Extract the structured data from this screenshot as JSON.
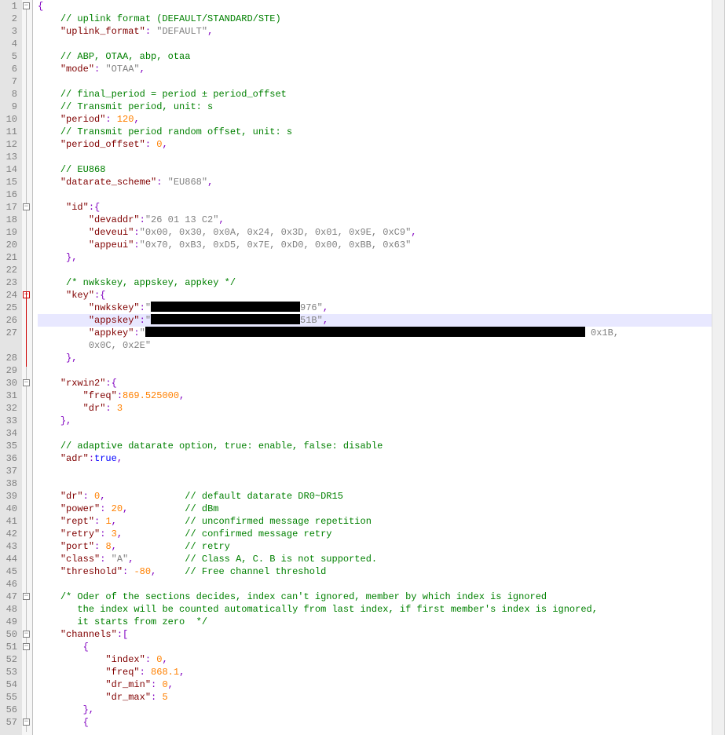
{
  "lines": {
    "l1": {
      "t": [
        {
          "c": "p",
          "v": "{"
        }
      ]
    },
    "l2": {
      "t": [
        {
          "c": "",
          "v": "    "
        },
        {
          "c": "c",
          "v": "// uplink format (DEFAULT/STANDARD/STE)"
        }
      ]
    },
    "l3": {
      "t": [
        {
          "c": "",
          "v": "    "
        },
        {
          "c": "k",
          "v": "\"uplink_format\""
        },
        {
          "c": "p",
          "v": ": "
        },
        {
          "c": "s",
          "v": "\"DEFAULT\""
        },
        {
          "c": "p",
          "v": ","
        }
      ]
    },
    "l4": {
      "t": [
        {
          "c": "",
          "v": ""
        }
      ]
    },
    "l5": {
      "t": [
        {
          "c": "",
          "v": "    "
        },
        {
          "c": "c",
          "v": "// ABP, OTAA, abp, otaa"
        }
      ]
    },
    "l6": {
      "t": [
        {
          "c": "",
          "v": "    "
        },
        {
          "c": "k",
          "v": "\"mode\""
        },
        {
          "c": "p",
          "v": ": "
        },
        {
          "c": "s",
          "v": "\"OTAA\""
        },
        {
          "c": "p",
          "v": ","
        }
      ]
    },
    "l7": {
      "t": [
        {
          "c": "",
          "v": ""
        }
      ]
    },
    "l8": {
      "t": [
        {
          "c": "",
          "v": "    "
        },
        {
          "c": "c",
          "v": "// final_period = period ± period_offset"
        }
      ]
    },
    "l9": {
      "t": [
        {
          "c": "",
          "v": "    "
        },
        {
          "c": "c",
          "v": "// Transmit period, unit: s"
        }
      ]
    },
    "l10": {
      "t": [
        {
          "c": "",
          "v": "    "
        },
        {
          "c": "k",
          "v": "\"period\""
        },
        {
          "c": "p",
          "v": ": "
        },
        {
          "c": "n",
          "v": "120"
        },
        {
          "c": "p",
          "v": ","
        }
      ]
    },
    "l11": {
      "t": [
        {
          "c": "",
          "v": "    "
        },
        {
          "c": "c",
          "v": "// Transmit period random offset, unit: s"
        }
      ]
    },
    "l12": {
      "t": [
        {
          "c": "",
          "v": "    "
        },
        {
          "c": "k",
          "v": "\"period_offset\""
        },
        {
          "c": "p",
          "v": ": "
        },
        {
          "c": "n",
          "v": "0"
        },
        {
          "c": "p",
          "v": ","
        }
      ]
    },
    "l13": {
      "t": [
        {
          "c": "",
          "v": ""
        }
      ]
    },
    "l14": {
      "t": [
        {
          "c": "",
          "v": "    "
        },
        {
          "c": "c",
          "v": "// EU868"
        }
      ]
    },
    "l15": {
      "t": [
        {
          "c": "",
          "v": "    "
        },
        {
          "c": "k",
          "v": "\"datarate_scheme\""
        },
        {
          "c": "p",
          "v": ": "
        },
        {
          "c": "s",
          "v": "\"EU868\""
        },
        {
          "c": "p",
          "v": ","
        }
      ]
    },
    "l16": {
      "t": [
        {
          "c": "",
          "v": ""
        }
      ]
    },
    "l17": {
      "t": [
        {
          "c": "",
          "v": "     "
        },
        {
          "c": "k",
          "v": "\"id\""
        },
        {
          "c": "p",
          "v": ":{"
        }
      ]
    },
    "l18": {
      "t": [
        {
          "c": "",
          "v": "         "
        },
        {
          "c": "k",
          "v": "\"devaddr\""
        },
        {
          "c": "p",
          "v": ":"
        },
        {
          "c": "s",
          "v": "\"26 01 13 C2\""
        },
        {
          "c": "p",
          "v": ","
        }
      ]
    },
    "l19": {
      "t": [
        {
          "c": "",
          "v": "         "
        },
        {
          "c": "k",
          "v": "\"deveui\""
        },
        {
          "c": "p",
          "v": ":"
        },
        {
          "c": "s",
          "v": "\"0x00, 0x30, 0x0A, 0x24, 0x3D, 0x01, 0x9E, 0xC9\""
        },
        {
          "c": "p",
          "v": ","
        }
      ]
    },
    "l20": {
      "t": [
        {
          "c": "",
          "v": "         "
        },
        {
          "c": "k",
          "v": "\"appeui\""
        },
        {
          "c": "p",
          "v": ":"
        },
        {
          "c": "s",
          "v": "\"0x70, 0xB3, 0xD5, 0x7E, 0xD0, 0x00, 0xBB, 0x63\""
        }
      ]
    },
    "l21": {
      "t": [
        {
          "c": "",
          "v": "     "
        },
        {
          "c": "p",
          "v": "},"
        }
      ]
    },
    "l22": {
      "t": [
        {
          "c": "",
          "v": ""
        }
      ]
    },
    "l23": {
      "t": [
        {
          "c": "",
          "v": "     "
        },
        {
          "c": "c",
          "v": "/* nwkskey, appskey, appkey */"
        }
      ]
    },
    "l24": {
      "t": [
        {
          "c": "",
          "v": "     "
        },
        {
          "c": "k",
          "v": "\"key\""
        },
        {
          "c": "p",
          "v": ":{"
        }
      ]
    },
    "l25": {
      "t": [
        {
          "c": "",
          "v": "         "
        },
        {
          "c": "k",
          "v": "\"nwkskey\""
        },
        {
          "c": "p",
          "v": ":"
        },
        {
          "c": "s",
          "v": "\""
        },
        {
          "redact": 190
        },
        {
          "c": "s",
          "v": "976\""
        },
        {
          "c": "p",
          "v": ","
        }
      ]
    },
    "l26": {
      "t": [
        {
          "c": "",
          "v": "         "
        },
        {
          "c": "k",
          "v": "\"appskey\""
        },
        {
          "c": "p",
          "v": ":"
        },
        {
          "c": "s",
          "v": "\""
        },
        {
          "redact": 190
        },
        {
          "c": "s",
          "v": "51B\""
        },
        {
          "c": "p",
          "v": ","
        }
      ],
      "hl": true
    },
    "l27": {
      "t": [
        {
          "c": "",
          "v": "         "
        },
        {
          "c": "k",
          "v": "\"appkey\""
        },
        {
          "c": "p",
          "v": ":"
        },
        {
          "c": "s",
          "v": "\""
        },
        {
          "redact": 560
        },
        {
          "c": "s",
          "v": " 0x1B, 0x0C, 0x2E\""
        }
      ]
    },
    "l28": {
      "t": [
        {
          "c": "",
          "v": "     "
        },
        {
          "c": "p",
          "v": "},"
        }
      ]
    },
    "l29": {
      "t": [
        {
          "c": "",
          "v": ""
        }
      ]
    },
    "l30": {
      "t": [
        {
          "c": "",
          "v": "    "
        },
        {
          "c": "k",
          "v": "\"rxwin2\""
        },
        {
          "c": "p",
          "v": ":{"
        }
      ]
    },
    "l31": {
      "t": [
        {
          "c": "",
          "v": "        "
        },
        {
          "c": "k",
          "v": "\"freq\""
        },
        {
          "c": "p",
          "v": ":"
        },
        {
          "c": "n",
          "v": "869.525000"
        },
        {
          "c": "p",
          "v": ","
        }
      ]
    },
    "l32": {
      "t": [
        {
          "c": "",
          "v": "        "
        },
        {
          "c": "k",
          "v": "\"dr\""
        },
        {
          "c": "p",
          "v": ": "
        },
        {
          "c": "n",
          "v": "3"
        }
      ]
    },
    "l33": {
      "t": [
        {
          "c": "",
          "v": "    "
        },
        {
          "c": "p",
          "v": "},"
        }
      ]
    },
    "l34": {
      "t": [
        {
          "c": "",
          "v": ""
        }
      ]
    },
    "l35": {
      "t": [
        {
          "c": "",
          "v": "    "
        },
        {
          "c": "c",
          "v": "// adaptive datarate option, true: enable, false: disable"
        }
      ]
    },
    "l36": {
      "t": [
        {
          "c": "",
          "v": "    "
        },
        {
          "c": "k",
          "v": "\"adr\""
        },
        {
          "c": "p",
          "v": ":"
        },
        {
          "c": "b",
          "v": "true"
        },
        {
          "c": "p",
          "v": ","
        }
      ]
    },
    "l37": {
      "t": [
        {
          "c": "",
          "v": ""
        }
      ]
    },
    "l38": {
      "t": [
        {
          "c": "",
          "v": ""
        }
      ]
    },
    "l39": {
      "t": [
        {
          "c": "",
          "v": "    "
        },
        {
          "c": "k",
          "v": "\"dr\""
        },
        {
          "c": "p",
          "v": ": "
        },
        {
          "c": "n",
          "v": "0"
        },
        {
          "c": "p",
          "v": ","
        },
        {
          "c": "",
          "v": "              "
        },
        {
          "c": "c",
          "v": "// default datarate DR0~DR15"
        }
      ]
    },
    "l40": {
      "t": [
        {
          "c": "",
          "v": "    "
        },
        {
          "c": "k",
          "v": "\"power\""
        },
        {
          "c": "p",
          "v": ": "
        },
        {
          "c": "n",
          "v": "20"
        },
        {
          "c": "p",
          "v": ","
        },
        {
          "c": "",
          "v": "          "
        },
        {
          "c": "c",
          "v": "// dBm"
        }
      ]
    },
    "l41": {
      "t": [
        {
          "c": "",
          "v": "    "
        },
        {
          "c": "k",
          "v": "\"rept\""
        },
        {
          "c": "p",
          "v": ": "
        },
        {
          "c": "n",
          "v": "1"
        },
        {
          "c": "p",
          "v": ","
        },
        {
          "c": "",
          "v": "            "
        },
        {
          "c": "c",
          "v": "// unconfirmed message repetition"
        }
      ]
    },
    "l42": {
      "t": [
        {
          "c": "",
          "v": "    "
        },
        {
          "c": "k",
          "v": "\"retry\""
        },
        {
          "c": "p",
          "v": ": "
        },
        {
          "c": "n",
          "v": "3"
        },
        {
          "c": "p",
          "v": ","
        },
        {
          "c": "",
          "v": "           "
        },
        {
          "c": "c",
          "v": "// confirmed message retry"
        }
      ]
    },
    "l43": {
      "t": [
        {
          "c": "",
          "v": "    "
        },
        {
          "c": "k",
          "v": "\"port\""
        },
        {
          "c": "p",
          "v": ": "
        },
        {
          "c": "n",
          "v": "8"
        },
        {
          "c": "p",
          "v": ","
        },
        {
          "c": "",
          "v": "            "
        },
        {
          "c": "c",
          "v": "// retry"
        }
      ]
    },
    "l44": {
      "t": [
        {
          "c": "",
          "v": "    "
        },
        {
          "c": "k",
          "v": "\"class\""
        },
        {
          "c": "p",
          "v": ": "
        },
        {
          "c": "s",
          "v": "\"A\""
        },
        {
          "c": "p",
          "v": ","
        },
        {
          "c": "",
          "v": "         "
        },
        {
          "c": "c",
          "v": "// Class A, C. B is not supported."
        }
      ]
    },
    "l45": {
      "t": [
        {
          "c": "",
          "v": "    "
        },
        {
          "c": "k",
          "v": "\"threshold\""
        },
        {
          "c": "p",
          "v": ": "
        },
        {
          "c": "n",
          "v": "-80"
        },
        {
          "c": "p",
          "v": ","
        },
        {
          "c": "",
          "v": "     "
        },
        {
          "c": "c",
          "v": "// Free channel threshold"
        }
      ]
    },
    "l46": {
      "t": [
        {
          "c": "",
          "v": ""
        }
      ]
    },
    "l47": {
      "t": [
        {
          "c": "",
          "v": "    "
        },
        {
          "c": "c",
          "v": "/* Oder of the sections decides, index can't ignored, member by which index is ignored"
        }
      ]
    },
    "l48": {
      "t": [
        {
          "c": "",
          "v": "       "
        },
        {
          "c": "c",
          "v": "the index will be counted automatically from last index, if first member's index is ignored,"
        }
      ]
    },
    "l49": {
      "t": [
        {
          "c": "",
          "v": "       "
        },
        {
          "c": "c",
          "v": "it starts from zero  */"
        }
      ]
    },
    "l50": {
      "t": [
        {
          "c": "",
          "v": "    "
        },
        {
          "c": "k",
          "v": "\"channels\""
        },
        {
          "c": "p",
          "v": ":["
        }
      ]
    },
    "l51": {
      "t": [
        {
          "c": "",
          "v": "        "
        },
        {
          "c": "p",
          "v": "{"
        }
      ]
    },
    "l52": {
      "t": [
        {
          "c": "",
          "v": "            "
        },
        {
          "c": "k",
          "v": "\"index\""
        },
        {
          "c": "p",
          "v": ": "
        },
        {
          "c": "n",
          "v": "0"
        },
        {
          "c": "p",
          "v": ","
        }
      ]
    },
    "l53": {
      "t": [
        {
          "c": "",
          "v": "            "
        },
        {
          "c": "k",
          "v": "\"freq\""
        },
        {
          "c": "p",
          "v": ": "
        },
        {
          "c": "n",
          "v": "868.1"
        },
        {
          "c": "p",
          "v": ","
        }
      ]
    },
    "l54": {
      "t": [
        {
          "c": "",
          "v": "            "
        },
        {
          "c": "k",
          "v": "\"dr_min\""
        },
        {
          "c": "p",
          "v": ": "
        },
        {
          "c": "n",
          "v": "0"
        },
        {
          "c": "p",
          "v": ","
        }
      ]
    },
    "l55": {
      "t": [
        {
          "c": "",
          "v": "            "
        },
        {
          "c": "k",
          "v": "\"dr_max\""
        },
        {
          "c": "p",
          "v": ": "
        },
        {
          "c": "n",
          "v": "5"
        }
      ]
    },
    "l56": {
      "t": [
        {
          "c": "",
          "v": "        "
        },
        {
          "c": "p",
          "v": "},"
        }
      ]
    },
    "l57": {
      "t": [
        {
          "c": "",
          "v": "        "
        },
        {
          "c": "p",
          "v": "{"
        }
      ]
    }
  },
  "fold_markers": [
    {
      "line": 1,
      "type": "minus"
    },
    {
      "line": 17,
      "type": "minus"
    },
    {
      "line": 24,
      "type": "minus-red"
    },
    {
      "line": 30,
      "type": "minus"
    },
    {
      "line": 47,
      "type": "minus"
    },
    {
      "line": 50,
      "type": "minus"
    },
    {
      "line": 51,
      "type": "minus"
    },
    {
      "line": 57,
      "type": "minus"
    }
  ]
}
